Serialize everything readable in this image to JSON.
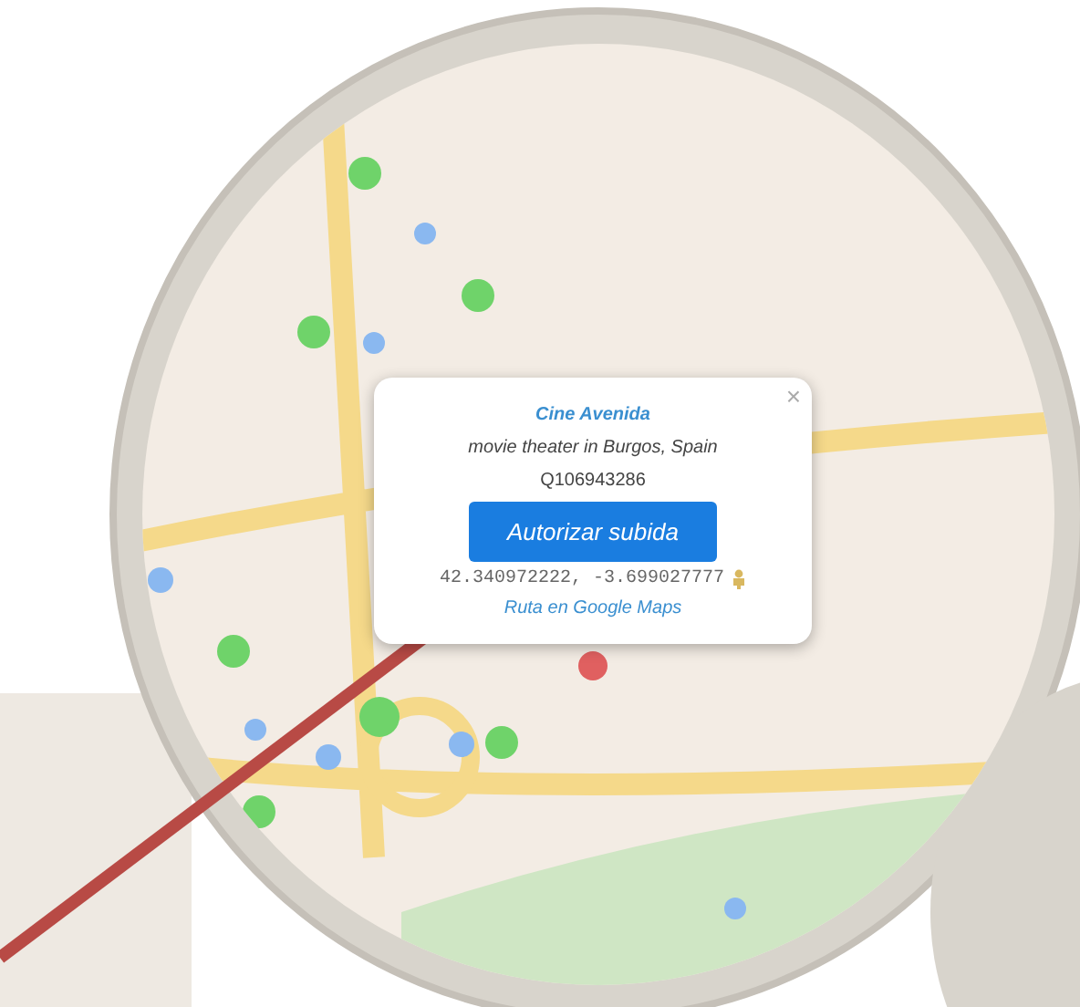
{
  "popup": {
    "title": "Cine Avenida",
    "description": "movie theater in Burgos, Spain",
    "item_id": "Q106943286",
    "close": "×",
    "button": "Autorizar subida",
    "coordinates": "42.340972222, -3.699027777",
    "link": "Ruta en Google Maps"
  }
}
